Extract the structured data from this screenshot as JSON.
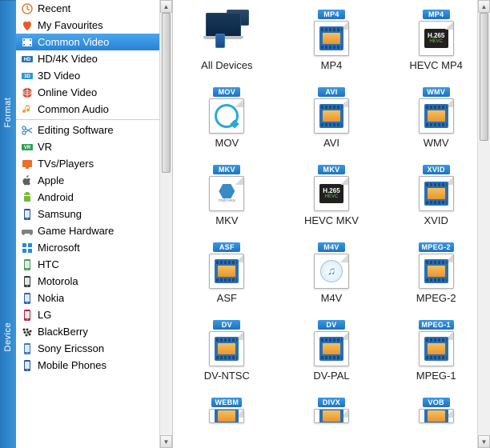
{
  "sidebar": {
    "tabs": [
      "Format",
      "Device"
    ],
    "sections": [
      {
        "items": [
          {
            "id": "recent",
            "label": "Recent",
            "icon": "clock-icon",
            "color": "#e08030"
          },
          {
            "id": "favourites",
            "label": "My Favourites",
            "icon": "heart-icon",
            "color": "#e85a2a"
          },
          {
            "id": "common-video",
            "label": "Common Video",
            "icon": "film-icon",
            "color": "#fff",
            "selected": true
          },
          {
            "id": "hd-4k-video",
            "label": "HD/4K Video",
            "icon": "hd-badge-icon",
            "color": "#2a72b8"
          },
          {
            "id": "3d-video",
            "label": "3D Video",
            "icon": "3d-badge-icon",
            "color": "#2a98d8"
          },
          {
            "id": "online-video",
            "label": "Online Video",
            "icon": "globe-icon",
            "color": "#d04028"
          },
          {
            "id": "common-audio",
            "label": "Common Audio",
            "icon": "music-note-icon",
            "color": "#e8a030"
          }
        ]
      },
      {
        "items": [
          {
            "id": "editing-software",
            "label": "Editing Software",
            "icon": "scissors-icon",
            "color": "#3a88c8"
          },
          {
            "id": "vr",
            "label": "VR",
            "icon": "vr-badge-icon",
            "color": "#30a058"
          },
          {
            "id": "tvs-players",
            "label": "TVs/Players",
            "icon": "tv-icon",
            "color": "#e87028"
          },
          {
            "id": "apple",
            "label": "Apple",
            "icon": "apple-icon",
            "color": "#606060"
          },
          {
            "id": "android",
            "label": "Android",
            "icon": "android-icon",
            "color": "#78b838"
          },
          {
            "id": "samsung",
            "label": "Samsung",
            "icon": "phone-icon",
            "color": "#2a5a9a"
          },
          {
            "id": "game-hardware",
            "label": "Game Hardware",
            "icon": "gamepad-icon",
            "color": "#808080"
          },
          {
            "id": "microsoft",
            "label": "Microsoft",
            "icon": "windows-icon",
            "color": "#2a88d8"
          },
          {
            "id": "htc",
            "label": "HTC",
            "icon": "phone-icon",
            "color": "#4a9a4a"
          },
          {
            "id": "motorola",
            "label": "Motorola",
            "icon": "phone-icon",
            "color": "#3a3a3a"
          },
          {
            "id": "nokia",
            "label": "Nokia",
            "icon": "phone-icon",
            "color": "#2a62b8"
          },
          {
            "id": "lg",
            "label": "LG",
            "icon": "phone-icon",
            "color": "#b02848"
          },
          {
            "id": "blackberry",
            "label": "BlackBerry",
            "icon": "blackberry-icon",
            "color": "#303030"
          },
          {
            "id": "sony-ericsson",
            "label": "Sony Ericsson",
            "icon": "phone-icon",
            "color": "#3878b8"
          },
          {
            "id": "mobile-phones",
            "label": "Mobile Phones",
            "icon": "phone-icon",
            "color": "#2858a0"
          }
        ]
      }
    ]
  },
  "formats": [
    {
      "id": "all-devices",
      "label": "All Devices",
      "badge": "",
      "style": "devices"
    },
    {
      "id": "mp4",
      "label": "MP4",
      "badge": "MP4",
      "style": "film"
    },
    {
      "id": "hevc-mp4",
      "label": "HEVC MP4",
      "badge": "MP4",
      "style": "hevc"
    },
    {
      "id": "mov",
      "label": "MOV",
      "badge": "MOV",
      "style": "qt"
    },
    {
      "id": "avi",
      "label": "AVI",
      "badge": "AVI",
      "style": "film"
    },
    {
      "id": "wmv",
      "label": "WMV",
      "badge": "WMV",
      "style": "film"
    },
    {
      "id": "mkv",
      "label": "MKV",
      "badge": "MKV",
      "style": "mkv"
    },
    {
      "id": "hevc-mkv",
      "label": "HEVC MKV",
      "badge": "MKV",
      "style": "hevc"
    },
    {
      "id": "xvid",
      "label": "XVID",
      "badge": "XVID",
      "style": "film"
    },
    {
      "id": "asf",
      "label": "ASF",
      "badge": "ASF",
      "style": "film"
    },
    {
      "id": "m4v",
      "label": "M4V",
      "badge": "M4V",
      "style": "itunes"
    },
    {
      "id": "mpeg-2",
      "label": "MPEG-2",
      "badge": "MPEG-2",
      "style": "film"
    },
    {
      "id": "dv-ntsc",
      "label": "DV-NTSC",
      "badge": "DV",
      "style": "film"
    },
    {
      "id": "dv-pal",
      "label": "DV-PAL",
      "badge": "DV",
      "style": "film"
    },
    {
      "id": "mpeg-1",
      "label": "MPEG-1",
      "badge": "MPEG-1",
      "style": "film"
    },
    {
      "id": "webm",
      "label": "",
      "badge": "WEBM",
      "style": "film-partial"
    },
    {
      "id": "divx",
      "label": "",
      "badge": "DIVX",
      "style": "film-partial"
    },
    {
      "id": "vob",
      "label": "",
      "badge": "VOB",
      "style": "film-partial"
    }
  ]
}
